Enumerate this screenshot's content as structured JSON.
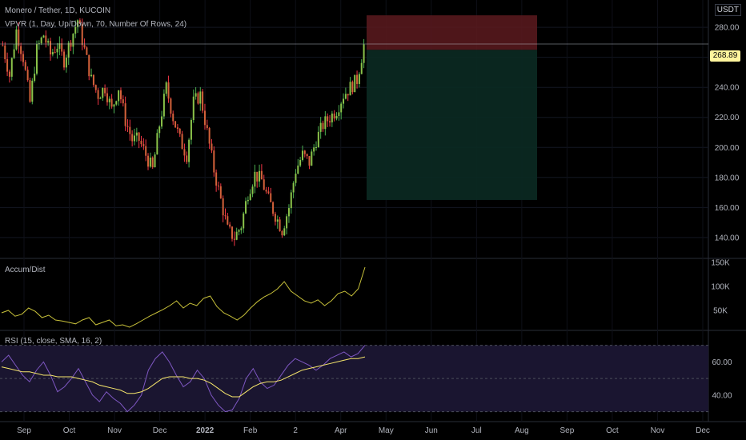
{
  "header": {
    "title": "Monero / Tether, 1D, KUCOIN",
    "vpvr_label": "VPVR (1, Day, Up/Down, 70, Number Of Rows, 24)",
    "currency": "USDT",
    "last_price": "268.89"
  },
  "panes": {
    "ad_label": "Accum/Dist",
    "rsi_label": "RSI (15, close, SMA, 16, 2)"
  },
  "colors": {
    "up": "#26a69a",
    "down": "#ef5350",
    "green_wick": "#4caf50",
    "red_wick": "#f23645",
    "ad_line": "#c7c03a",
    "rsi_line": "#7e57c2",
    "rsi_ma": "#f5e56b",
    "rsi_band": "#1a1530",
    "loss_zone": "#5c1a1f",
    "profit_zone": "#0b2a22"
  },
  "chart_data": [
    {
      "type": "candlestick",
      "title": "Monero / Tether, 1D, KUCOIN",
      "x_ticks": [
        "Sep",
        "Oct",
        "Nov",
        "Dec",
        "2022",
        "Feb",
        "2",
        "Apr",
        "May",
        "Jun",
        "Jul",
        "Aug",
        "Sep",
        "Oct",
        "Nov",
        "Dec"
      ],
      "y_ticks": [
        "280.00",
        "260.00",
        "240.00",
        "220.00",
        "200.00",
        "180.00",
        "160.00",
        "140.00"
      ],
      "ylim": [
        133,
        295
      ],
      "close_path": [
        268,
        248,
        278,
        260,
        230,
        265,
        275,
        262,
        268,
        258,
        272,
        285,
        265,
        245,
        235,
        240,
        225,
        240,
        218,
        205,
        205,
        195,
        185,
        215,
        240,
        220,
        205,
        195,
        230,
        235,
        210,
        185,
        165,
        145,
        140,
        148,
        170,
        182,
        178,
        165,
        155,
        145,
        160,
        185,
        195,
        190,
        205,
        215,
        220,
        225,
        235,
        240,
        245,
        268
      ],
      "position": {
        "type": "short",
        "stop_loss": 288,
        "entry": 265,
        "take_profit": 165,
        "last_price": 268.89
      }
    },
    {
      "type": "line",
      "title": "Accum/Dist",
      "y_ticks": [
        "150K",
        "100K",
        "50K"
      ],
      "ylim": [
        10,
        155
      ],
      "values": [
        45,
        50,
        38,
        42,
        55,
        48,
        35,
        40,
        30,
        28,
        25,
        22,
        30,
        35,
        20,
        25,
        30,
        18,
        20,
        15,
        22,
        30,
        38,
        45,
        52,
        60,
        70,
        55,
        65,
        60,
        75,
        80,
        58,
        45,
        38,
        30,
        40,
        55,
        68,
        78,
        85,
        95,
        110,
        90,
        80,
        70,
        65,
        72,
        60,
        70,
        85,
        90,
        80,
        95,
        140
      ]
    },
    {
      "type": "line",
      "title": "RSI (15, close, SMA, 16, 2)",
      "y_ticks": [
        "60.00",
        "40.00"
      ],
      "ylim": [
        25,
        78
      ],
      "band": [
        30,
        70
      ],
      "midline": 50,
      "series": [
        {
          "values": [
            60,
            64,
            58,
            52,
            48,
            55,
            60,
            52,
            42,
            45,
            50,
            56,
            48,
            40,
            36,
            42,
            38,
            35,
            30,
            34,
            40,
            55,
            62,
            66,
            60,
            52,
            45,
            48,
            55,
            50,
            40,
            34,
            30,
            31,
            38,
            50,
            56,
            48,
            44,
            46,
            52,
            58,
            62,
            60,
            58,
            55,
            58,
            62,
            64,
            66,
            63,
            65,
            70
          ]
        },
        {
          "values": [
            57,
            56,
            55,
            54,
            54,
            53,
            52,
            52,
            51,
            51,
            51,
            50,
            49,
            48,
            46,
            45,
            44,
            43,
            41,
            41,
            42,
            44,
            47,
            50,
            51,
            51,
            51,
            50,
            50,
            49,
            47,
            44,
            41,
            39,
            39,
            42,
            45,
            47,
            48,
            48,
            49,
            51,
            53,
            55,
            56,
            57,
            58,
            59,
            60,
            61,
            62,
            62,
            63
          ]
        }
      ]
    }
  ]
}
